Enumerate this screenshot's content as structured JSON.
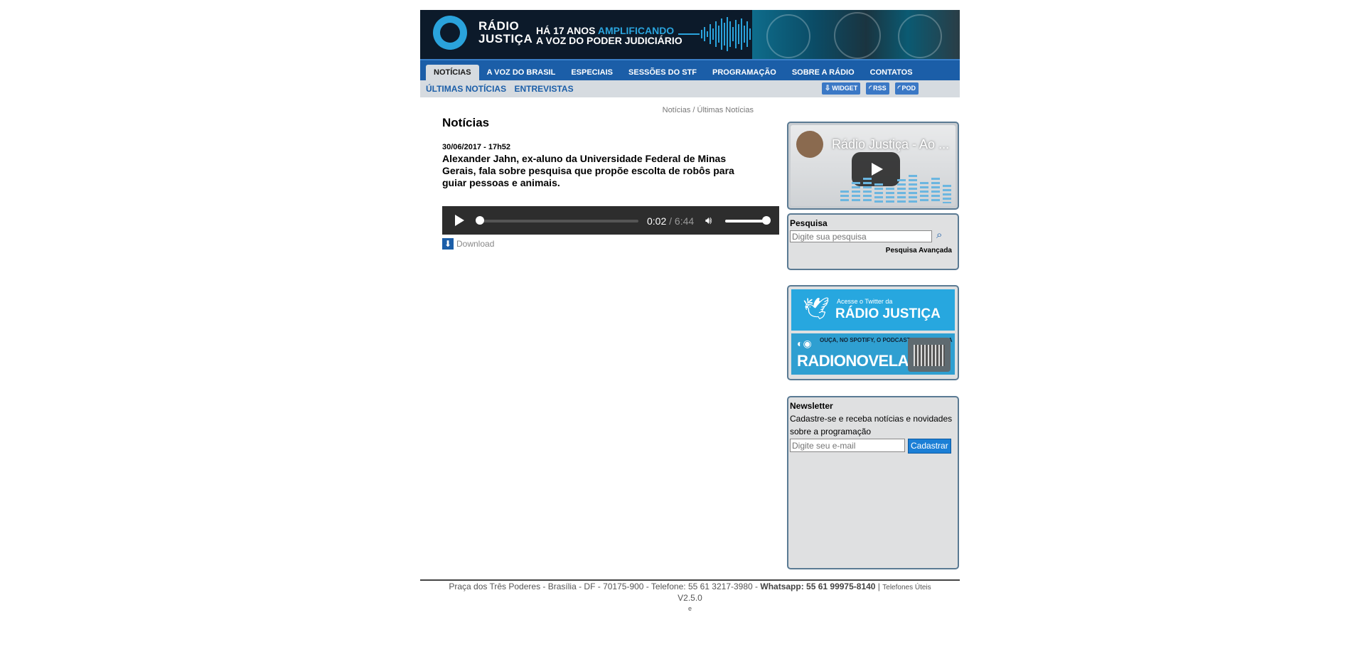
{
  "banner": {
    "logo_line1": "RÁDIO",
    "logo_line2": "JUSTIÇA",
    "tagline_prefix": "HÁ 17 ANOS ",
    "tagline_highlight": "AMPLIFICANDO",
    "tagline_line2": "A VOZ DO PODER JUDICIÁRIO"
  },
  "nav": {
    "items": [
      {
        "label": "NOTÍCIAS",
        "active": true
      },
      {
        "label": "A VOZ DO BRASIL"
      },
      {
        "label": "ESPECIAIS"
      },
      {
        "label": "SESSÕES DO STF"
      },
      {
        "label": "PROGRAMAÇÃO"
      },
      {
        "label": "SOBRE A RÁDIO"
      },
      {
        "label": "CONTATOS"
      }
    ]
  },
  "subnav": {
    "links": [
      "ÚLTIMAS NOTÍCIAS",
      "ENTREVISTAS"
    ],
    "badges": [
      "WIDGET",
      "RSS",
      "POD"
    ]
  },
  "main": {
    "breadcrumb": "Notícias / Últimas Notícias",
    "section_title": "Notícias",
    "date": "30/06/2017 - 17h52",
    "headline": "Alexander Jahn, ex-aluno da Universidade Federal de Minas Gerais, fala sobre pesquisa que propõe escolta de robôs para guiar pessoas e animais.",
    "player": {
      "current_time": "0:02",
      "separator": " / ",
      "duration": "6:44",
      "progress": 0.005,
      "volume": 1.0
    },
    "download_label": "Download"
  },
  "sidebar": {
    "video": {
      "title": "Rádio Justiça - Ao ...",
      "channel": "RÁDIO JUSTIÇA"
    },
    "search": {
      "label": "Pesquisa",
      "placeholder": "Digite sua pesquisa",
      "advanced_label": "Pesquisa Avançada"
    },
    "twitter": {
      "line1": "Acesse o Twitter da",
      "line2": "RÁDIO JUSTIÇA"
    },
    "radionovela": {
      "line1": "OUÇA, NO SPOTIFY, O PODCAST COM A NOSSA",
      "line2": "RADIONOVELA"
    },
    "newsletter": {
      "label": "Newsletter",
      "description": "Cadastre-se e receba notícias e novidades sobre a programação",
      "placeholder": "Digite seu e-mail",
      "button_label": "Cadastrar"
    }
  },
  "footer": {
    "address": "Praça dos Três Poderes - Brasília - DF - 70175-900 - Telefone: 55 61 3217-3980 - ",
    "whatsapp": "Whatsapp: 55 61 99975-8140",
    "pipe": " | ",
    "phones_link": "Telefones Úteis",
    "version": "V2.5.0",
    "extra": "e"
  },
  "colors": {
    "nav_blue": "#1b5ea8",
    "accent_cyan": "#2aa3dc",
    "sidebar_bg": "#dfe0e1"
  }
}
